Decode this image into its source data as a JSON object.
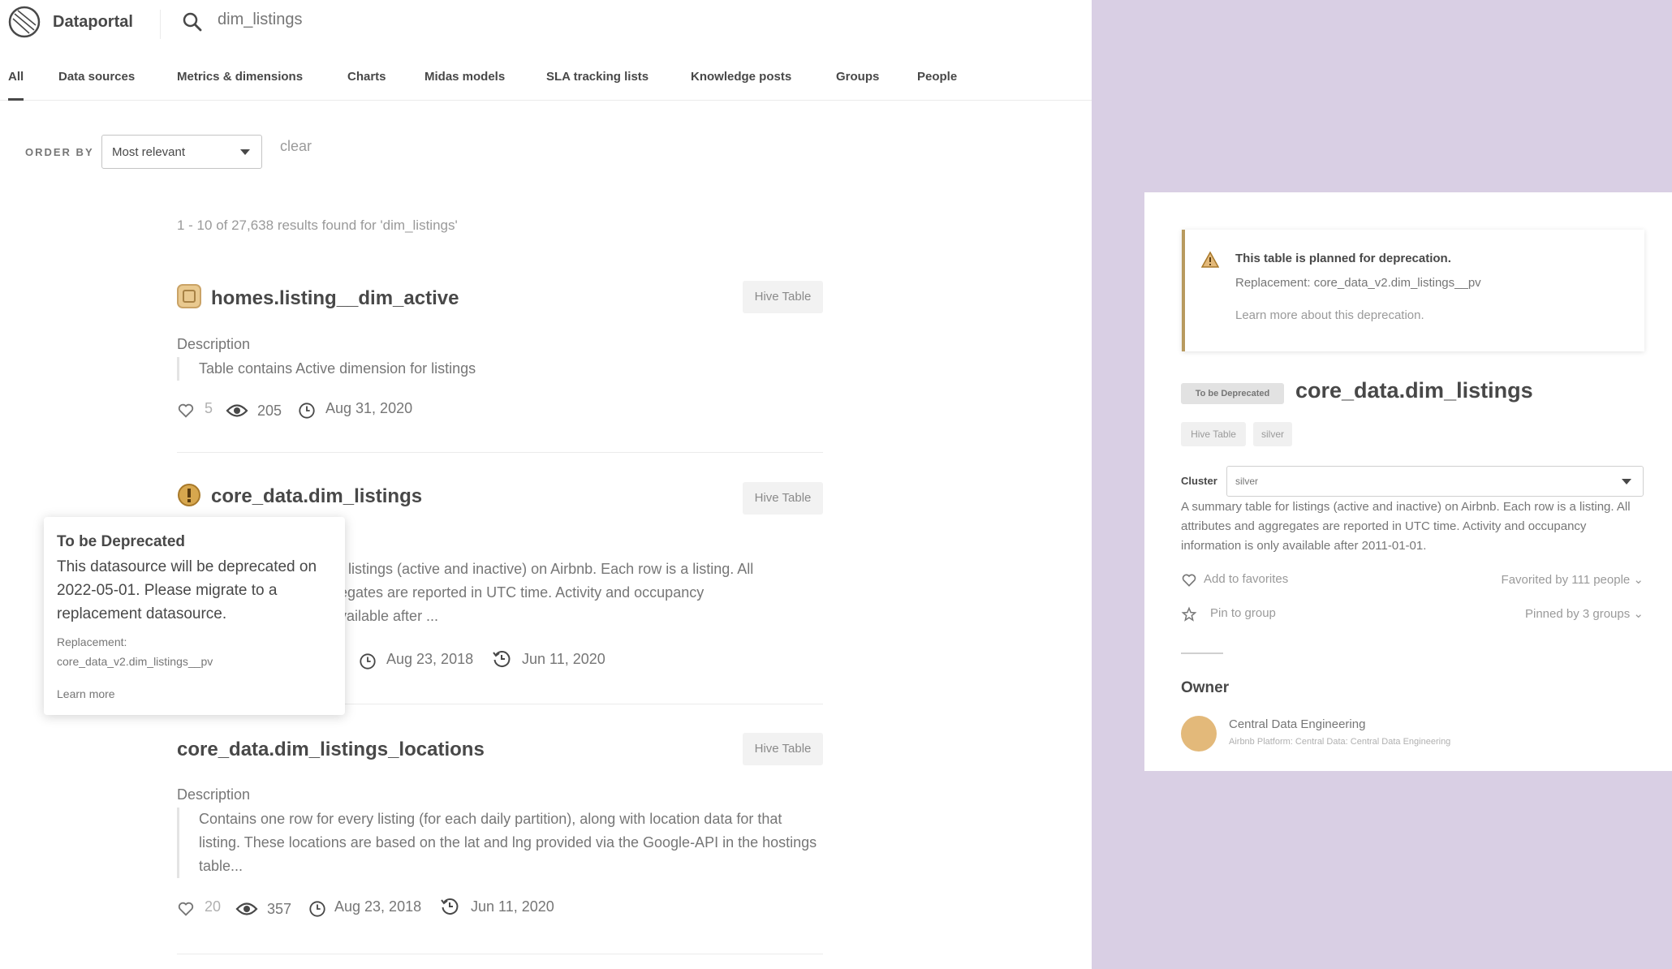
{
  "app": {
    "name": "Dataportal",
    "search_value": "dim_listings"
  },
  "tabs": [
    {
      "label": "All",
      "active": true
    },
    {
      "label": "Data sources"
    },
    {
      "label": "Metrics & dimensions"
    },
    {
      "label": "Charts"
    },
    {
      "label": "Midas models"
    },
    {
      "label": "SLA tracking lists"
    },
    {
      "label": "Knowledge posts"
    },
    {
      "label": "Groups"
    },
    {
      "label": "People"
    }
  ],
  "order": {
    "label": "ORDER BY",
    "selected": "Most relevant",
    "clear": "clear"
  },
  "results_summary": "1 - 10 of 27,638 results found for 'dim_listings'",
  "results": [
    {
      "title": "homes.listing__dim_active",
      "type": "Hive Table",
      "description_label": "Description",
      "description": "Table contains Active dimension for listings",
      "likes": "5",
      "views": "205",
      "created": "Aug 31, 2020"
    },
    {
      "title": "core_data.dim_listings",
      "type": "Hive Table",
      "description": "r listings (active and inactive) on Airbnb. Each row is a listing. All\negates are reported in UTC time. Activity and occupancy\nvailable after ...",
      "created": "Aug 23, 2018",
      "updated": "Jun 11, 2020"
    },
    {
      "title": "core_data.dim_listings_locations",
      "type": "Hive Table",
      "description_label": "Description",
      "description": "Contains one row for every listing (for each daily partition), along with location data for that listing. These locations are based on the lat and lng provided via the Google-API in the hostings table...",
      "likes": "20",
      "views": "357",
      "created": "Aug 23, 2018",
      "updated": "Jun 11, 2020"
    }
  ],
  "tooltip": {
    "title": "To be Deprecated",
    "body": "This datasource will be deprecated on 2022-05-01. Please migrate to a replacement datasource.",
    "replacement_label": "Replacement:",
    "replacement_value": "core_data_v2.dim_listings__pv",
    "learn_more": "Learn more"
  },
  "detail": {
    "warning_title": "This table is planned for deprecation.",
    "warning_replacement": "Replacement: core_data_v2.dim_listings__pv",
    "warning_learn": "Learn more about this deprecation.",
    "status_badge": "To be Deprecated",
    "title": "core_data.dim_listings",
    "tags": [
      "Hive Table",
      "silver"
    ],
    "cluster_label": "Cluster",
    "cluster_value": "silver",
    "description": "A summary table for listings (active and inactive) on Airbnb. Each row is a listing. All attributes and aggregates are reported in UTC time. Activity and occupancy information is only available after 2011-01-01.",
    "favorite_label": "Add to favorites",
    "favorited_by": "Favorited by 111 people",
    "pin_label": "Pin to group",
    "pinned_by": "Pinned by 3 groups",
    "owner_heading": "Owner",
    "owner_name": "Central Data Engineering",
    "owner_path": "Airbnb Platform: Central Data: Central Data Engineering"
  },
  "colors": {
    "right_background": "#d9cfe4",
    "warning_accent": "#b89a5e",
    "avatar": "#e3b97a"
  }
}
